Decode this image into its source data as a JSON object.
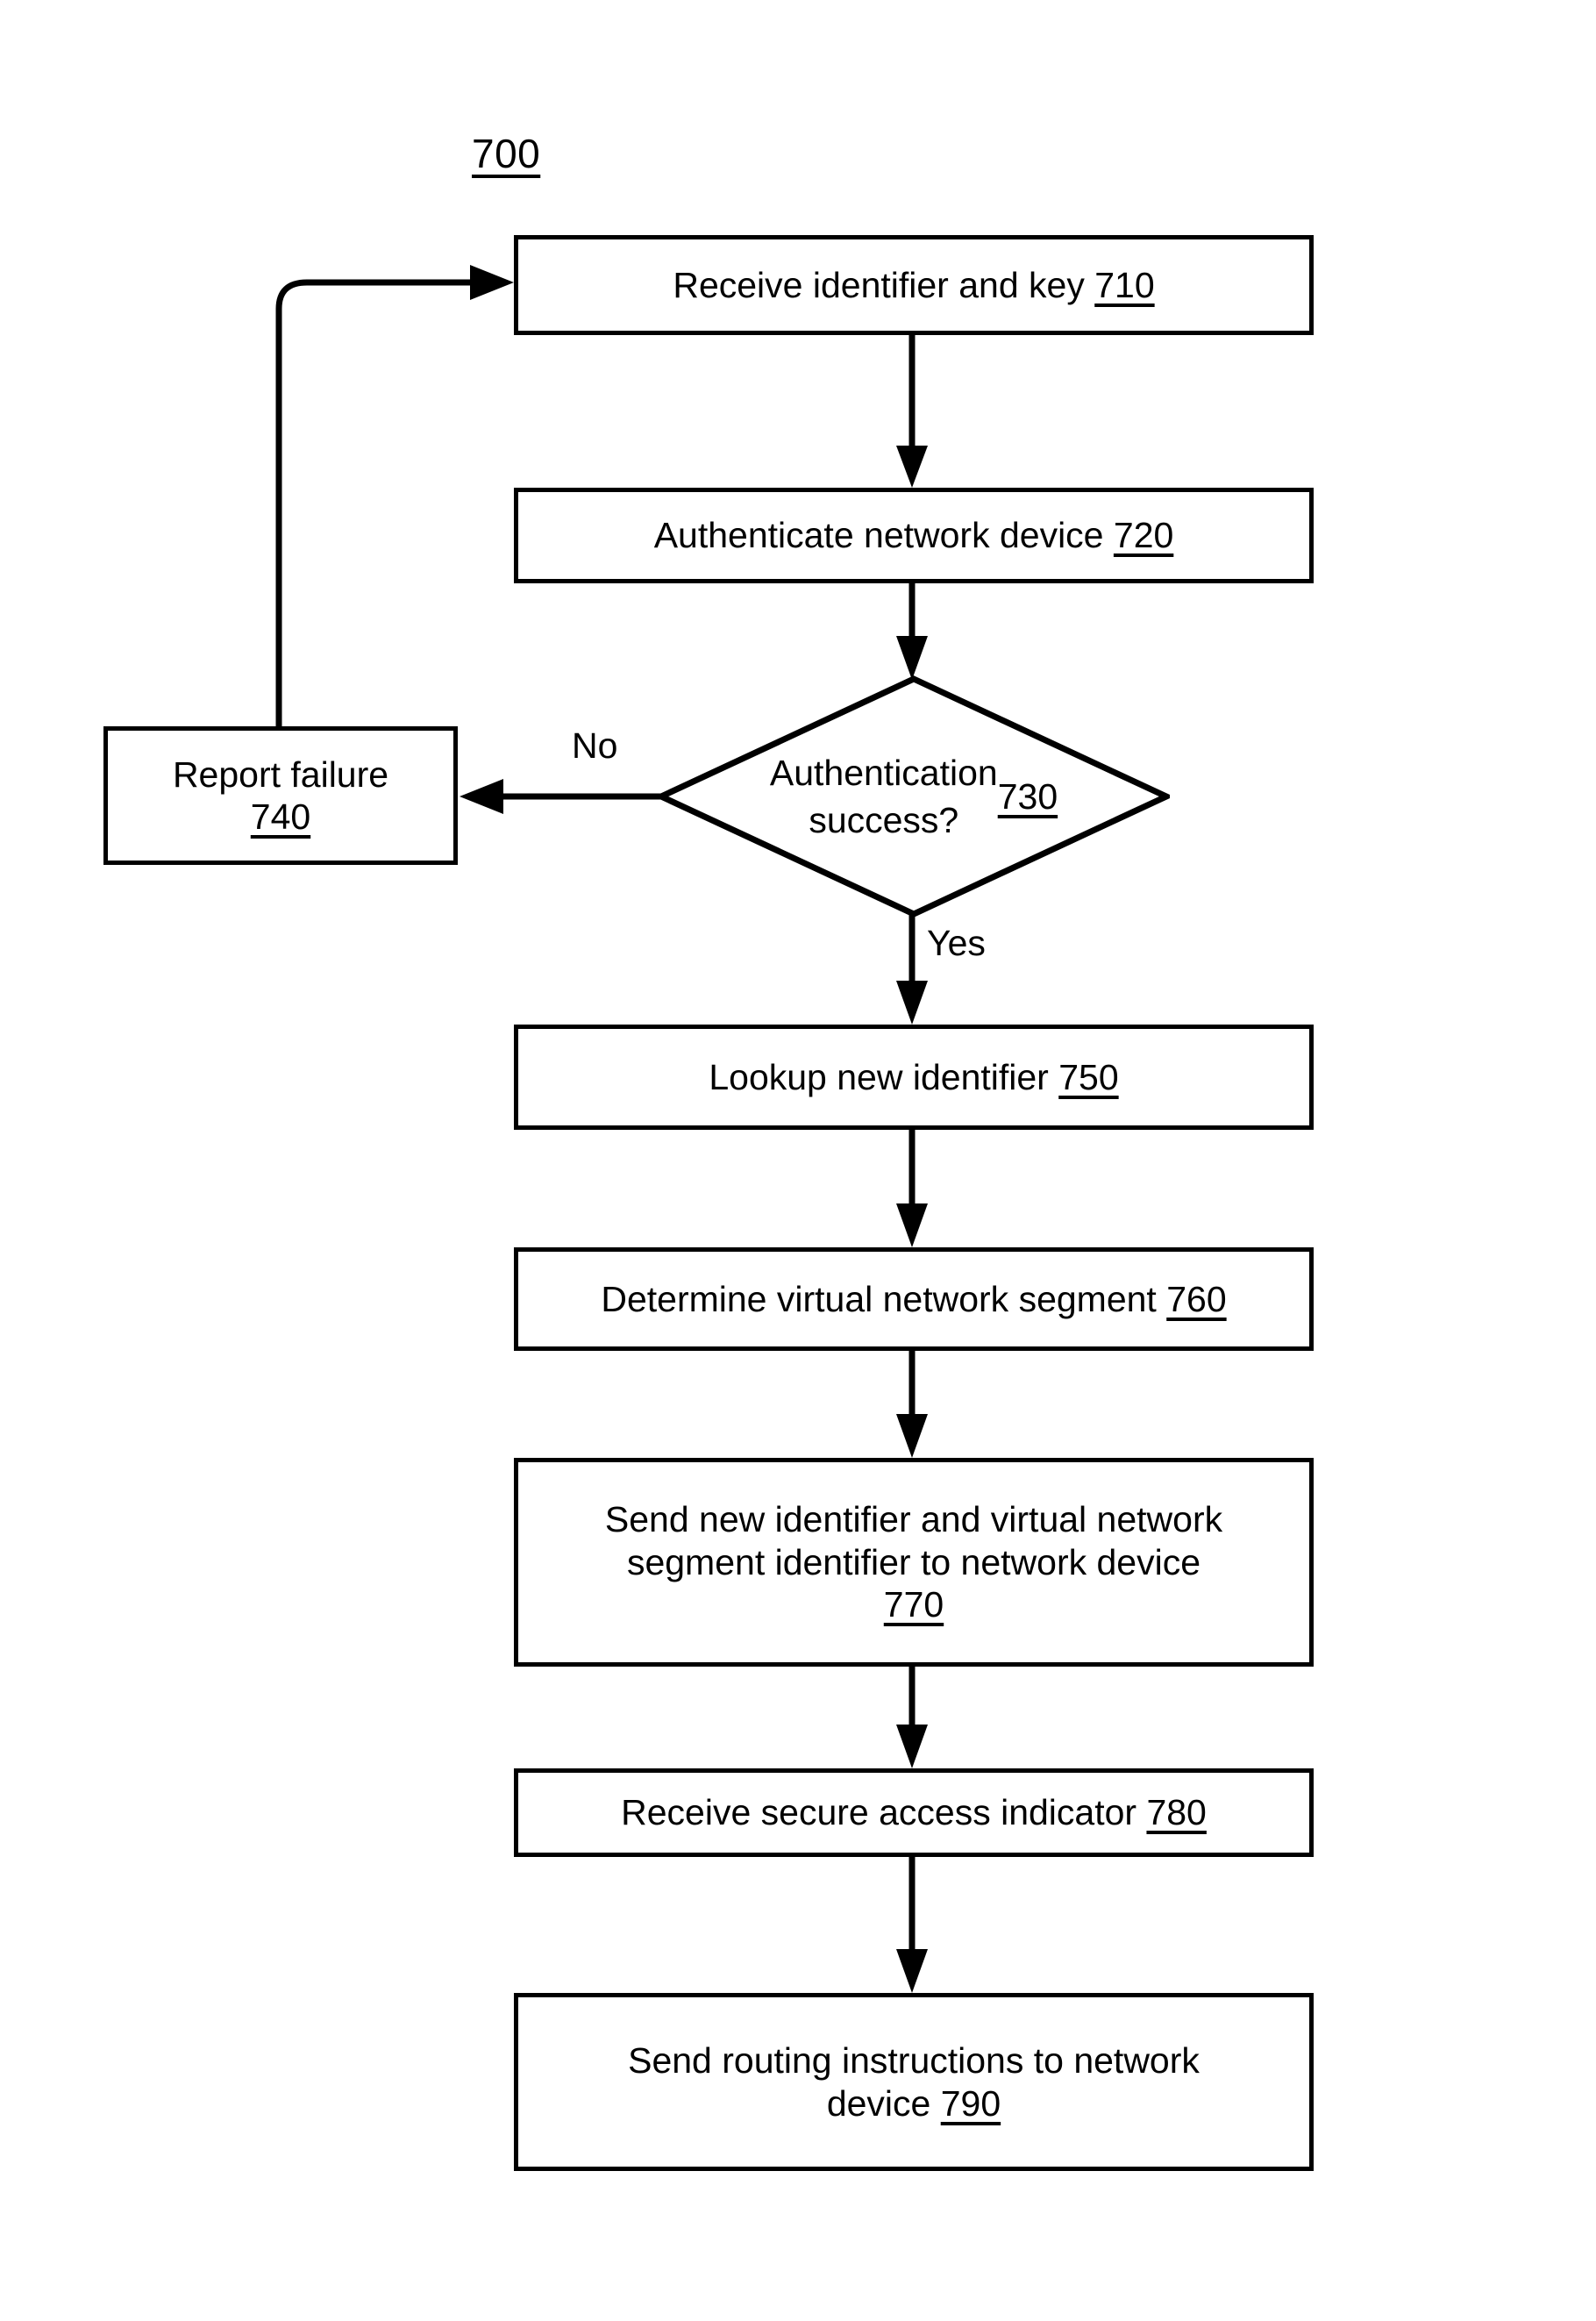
{
  "figure": {
    "number": "700"
  },
  "flowchart": {
    "type": "flowchart",
    "nodes": [
      {
        "id": "710",
        "shape": "process",
        "text": "Receive identifier and key ",
        "ref": "710"
      },
      {
        "id": "720",
        "shape": "process",
        "text": "Authenticate network device ",
        "ref": "720"
      },
      {
        "id": "730",
        "shape": "decision",
        "text": "Authentication\nsuccess? ",
        "ref": "730"
      },
      {
        "id": "740",
        "shape": "process",
        "text": "Report failure\n",
        "ref": "740"
      },
      {
        "id": "750",
        "shape": "process",
        "text": "Lookup new identifier ",
        "ref": "750"
      },
      {
        "id": "760",
        "shape": "process",
        "text": "Determine virtual network segment ",
        "ref": "760"
      },
      {
        "id": "770",
        "shape": "process",
        "text": "Send new identifier and virtual network\nsegment identifier to network device\n",
        "ref": "770"
      },
      {
        "id": "780",
        "shape": "process",
        "text": "Receive secure access indicator ",
        "ref": "780"
      },
      {
        "id": "790",
        "shape": "process",
        "text": "Send routing instructions to network\ndevice  ",
        "ref": "790"
      }
    ],
    "edges": [
      {
        "from": "710",
        "to": "720",
        "label": ""
      },
      {
        "from": "720",
        "to": "730",
        "label": ""
      },
      {
        "from": "730",
        "to": "740",
        "label": "No"
      },
      {
        "from": "730",
        "to": "750",
        "label": "Yes"
      },
      {
        "from": "740",
        "to": "710",
        "label": ""
      },
      {
        "from": "750",
        "to": "760",
        "label": ""
      },
      {
        "from": "760",
        "to": "770",
        "label": ""
      },
      {
        "from": "770",
        "to": "780",
        "label": ""
      },
      {
        "from": "780",
        "to": "790",
        "label": ""
      }
    ],
    "edge_labels": {
      "no": "No",
      "yes": "Yes"
    },
    "colors": {
      "stroke": "#000000",
      "fill": "#ffffff",
      "text": "#000000"
    }
  }
}
